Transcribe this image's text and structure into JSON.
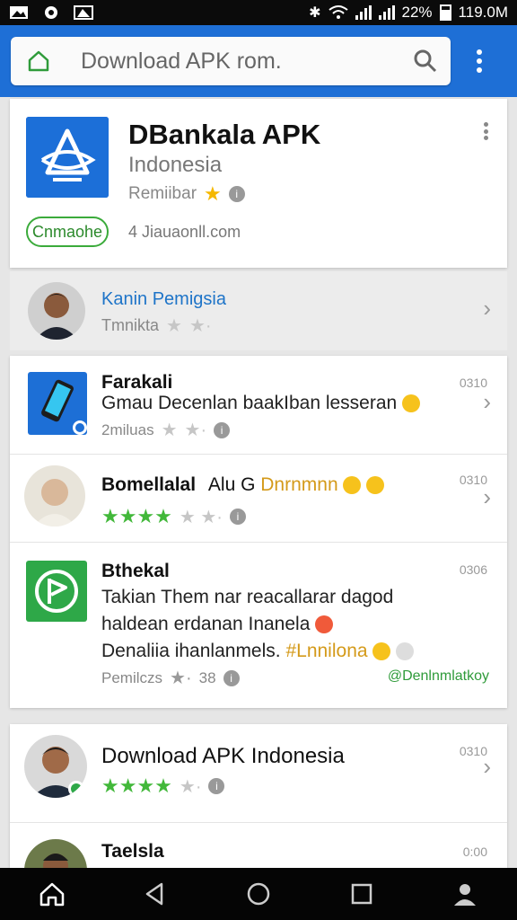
{
  "status_bar": {
    "battery": "22%",
    "data_rate": "119.0M"
  },
  "search": {
    "query": "Download APK rom."
  },
  "featured": {
    "title": "DBankala APK",
    "subtitle": "Indonesia",
    "rating_label": "Remiibar",
    "button_label": "Cnmaohe",
    "downloads": "4 Jiauaonll.com"
  },
  "developer": {
    "name": "Kanin Pemigsia",
    "sub": "Tmnikta"
  },
  "items": [
    {
      "title": "Farakali",
      "desc": "Gmau Decenlan baakIban lesseran",
      "meta": "2miluas",
      "time": "0310"
    },
    {
      "title": "Bomellalal",
      "title_extra": "Alu G",
      "title_orange": "Dnrnmnn",
      "time": "0310"
    },
    {
      "title": "Bthekal",
      "desc1": "Takian Them nar reacallarar dagod",
      "desc2": "haldean erdanan Inanela",
      "desc3": "Denaliia ihanlanmels.",
      "desc3_orange": "#Lnnilona",
      "meta": "Pemilczs",
      "meta_num": "38",
      "handle": "@Denlnmlatkoy",
      "time": "0306"
    },
    {
      "title": "Download APK Indonesia",
      "time": "0310"
    },
    {
      "title": "Taelsla",
      "time": "0:00"
    }
  ],
  "colors": {
    "accent": "#1e6fd6",
    "install": "#3bab3b",
    "star": "#f5b800",
    "green_star": "#42b83a"
  }
}
